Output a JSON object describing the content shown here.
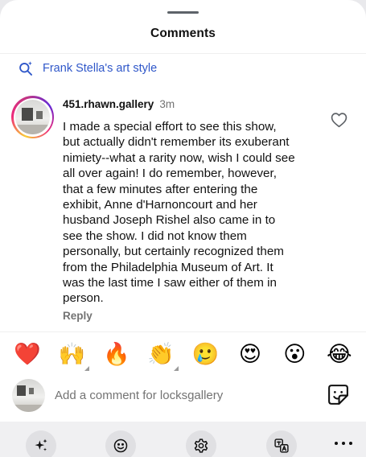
{
  "sheet": {
    "title": "Comments"
  },
  "search": {
    "label": "Frank Stella's art style",
    "icon": "search-sparkle-icon",
    "accent": "#2f57c9"
  },
  "comment": {
    "username": "451.rhawn.gallery",
    "time": "3m",
    "lines": [
      "I made a special effort to see this show,",
      "but actually didn't remember its exuberant",
      "nimiety--what a rarity now, wish I could see",
      "all over again! I do remember, however,",
      "that a few minutes after entering the",
      "exhibit, Anne d'Harnoncourt and her",
      "husband Joseph Rishel also came in to",
      "see the show. I did not know them",
      "personally, but certainly recognized them",
      "from the Philadelphia Museum of Art. It",
      "was the last time I saw either of them in",
      "person."
    ],
    "reply_label": "Reply",
    "like_icon": "heart-outline-icon"
  },
  "emoji_bar": [
    {
      "name": "red-heart",
      "char": "❤️",
      "tone": false
    },
    {
      "name": "raising-hands",
      "char": "🙌",
      "tone": true
    },
    {
      "name": "fire",
      "char": "🔥",
      "tone": false
    },
    {
      "name": "clapping-hands",
      "char": "👏",
      "tone": true
    },
    {
      "name": "crying-face",
      "char": "🥲",
      "tone": false
    },
    {
      "name": "heart-eyes",
      "char": "😍",
      "tone": false
    },
    {
      "name": "astonished-face",
      "char": "😮",
      "tone": false
    },
    {
      "name": "tears-of-joy",
      "char": "😂",
      "tone": false
    }
  ],
  "input": {
    "placeholder": "Add a comment for locksgallery",
    "value": ""
  },
  "toolbar": {
    "buttons": [
      "sparkle-icon",
      "smiley-icon",
      "gear-icon",
      "translate-icon",
      "more-icon"
    ]
  }
}
